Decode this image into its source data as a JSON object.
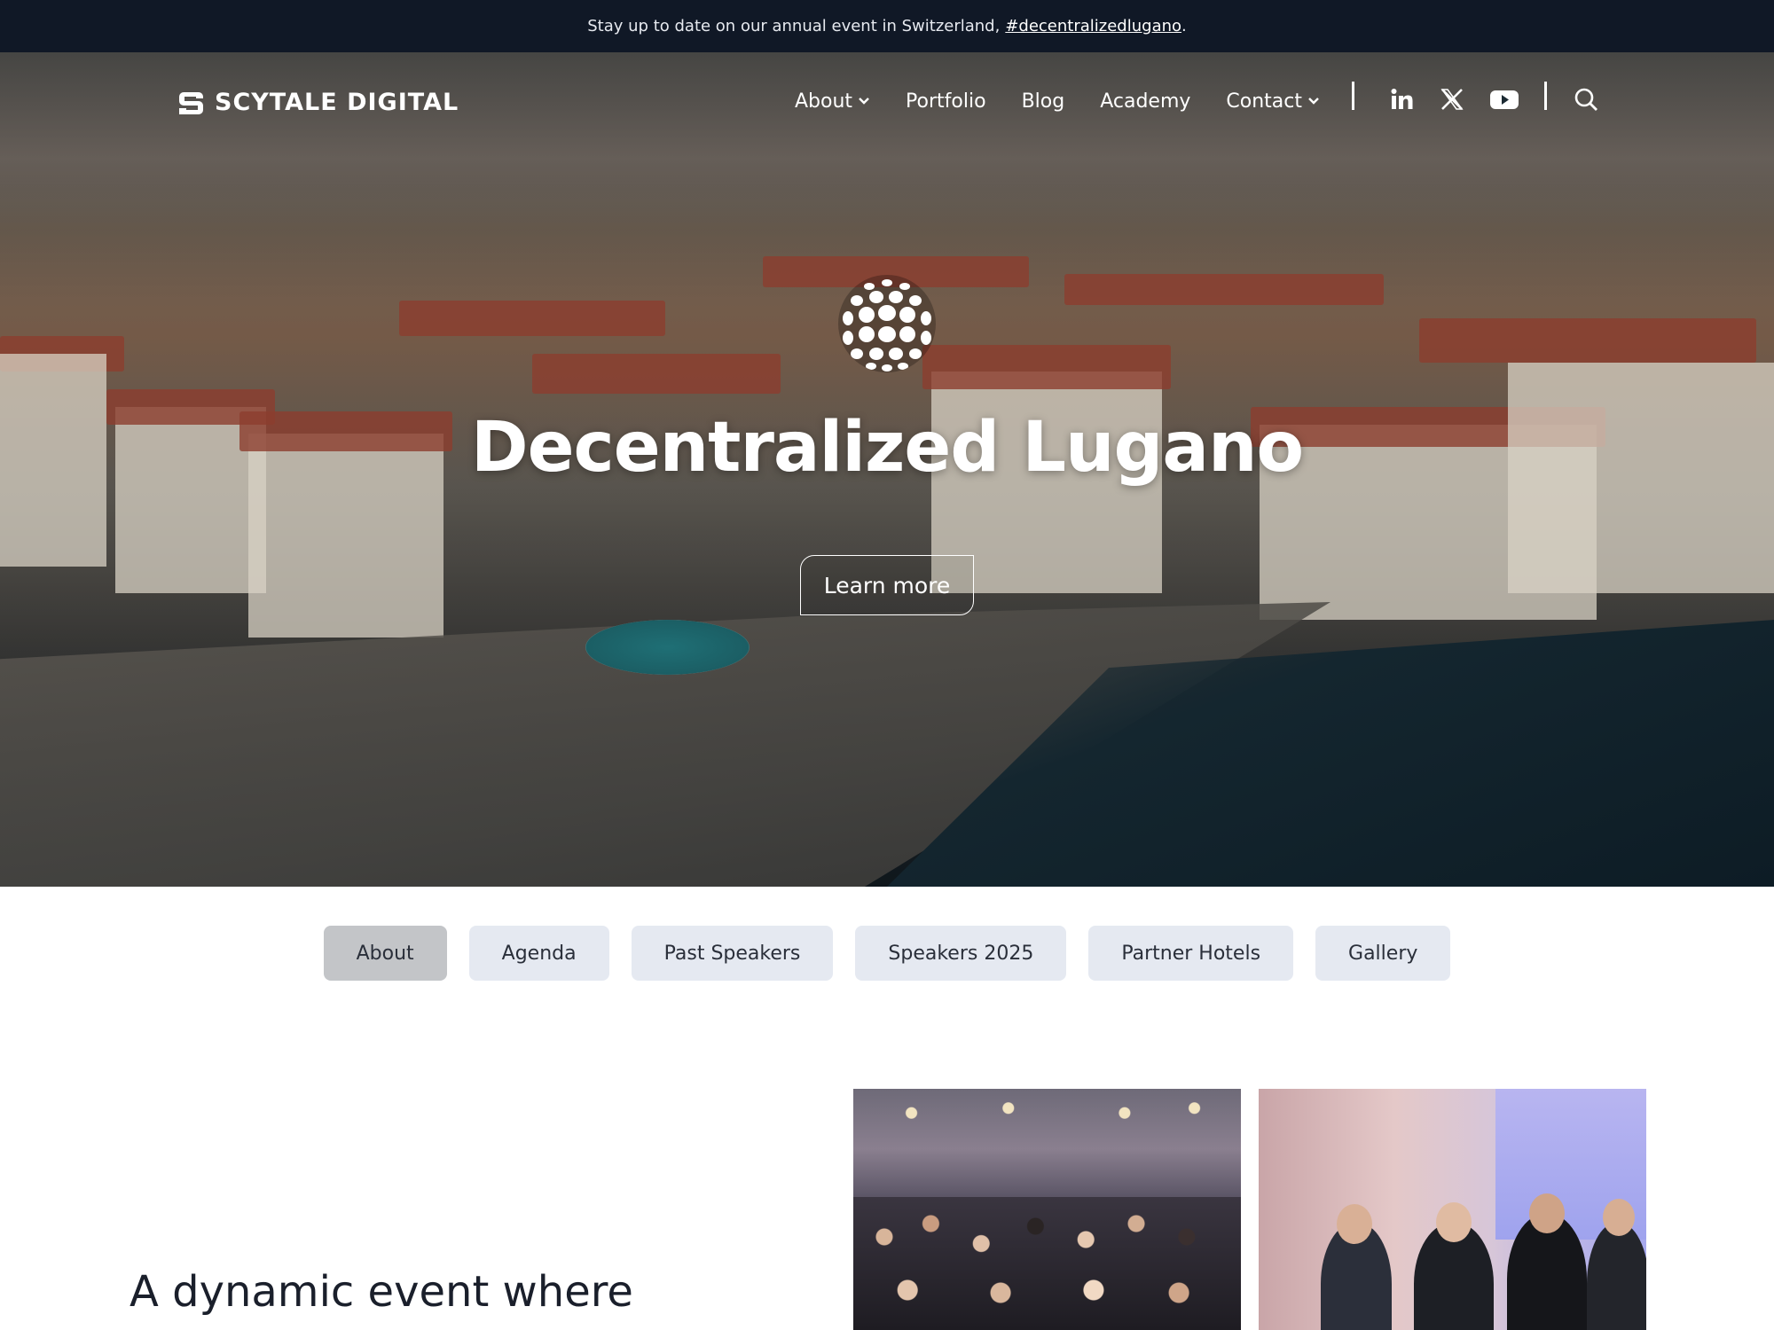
{
  "announcement": {
    "text": "Stay up to date on our annual event in Switzerland,",
    "link": "#decentralizedlugano",
    "suffix": "."
  },
  "nav": {
    "logo_text": "SCYTALE DIGITAL",
    "items": [
      {
        "label": "About",
        "dropdown": true
      },
      {
        "label": "Portfolio",
        "dropdown": false
      },
      {
        "label": "Blog",
        "dropdown": false
      },
      {
        "label": "Academy",
        "dropdown": false
      },
      {
        "label": "Contact",
        "dropdown": true
      }
    ],
    "social": [
      "linkedin-icon",
      "x-icon",
      "youtube-icon"
    ]
  },
  "hero": {
    "title": "Decentralized Lugano",
    "button": "Learn more"
  },
  "tabs": [
    {
      "label": "About",
      "active": true
    },
    {
      "label": "Agenda",
      "active": false
    },
    {
      "label": "Past Speakers",
      "active": false
    },
    {
      "label": "Speakers 2025",
      "active": false
    },
    {
      "label": "Partner Hotels",
      "active": false
    },
    {
      "label": "Gallery",
      "active": false
    }
  ],
  "content": {
    "headline_line1": "A dynamic event where"
  },
  "colors": {
    "announce_bg": "#101826",
    "tab_bg": "#e5e9f1",
    "tab_active_bg": "#c3c5c8",
    "text_dark": "#1a1f2b"
  }
}
